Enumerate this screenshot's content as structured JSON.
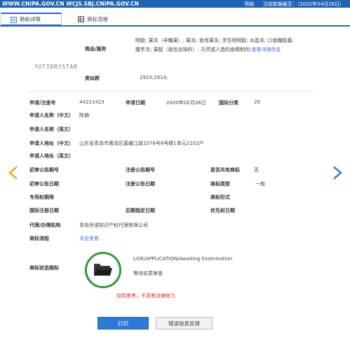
{
  "topbar": {
    "url": "WWW.CNIPA.GOV.CN WCJS.SBJ.CNIPA.GOV.CN",
    "help": "帮助",
    "data_date": "当前数据截至：（2020年04月28日）"
  },
  "tabs": [
    {
      "label": "商标详情",
      "active": true
    },
    {
      "label": "商标流程",
      "active": false
    }
  ],
  "logo": {
    "text": "YUTIDRYSTAR"
  },
  "fields": {
    "goods_label": "商品/服务",
    "goods_value": "明胶; 果冻（非糖果）; 果冻; 食用果冻; 烹饪用明胶; 水晶冻; 口香糖胶基; 魔芋冻; 果胶（面包涂抹料）; 天然或人造的香精制剂;",
    "goods_link": "查看详细信息",
    "similar_label": "类似群",
    "similar_value": "2910;2914;",
    "reg_no_label": "申请/注册号",
    "reg_no_value": "44221423",
    "apply_date_label": "申请日期",
    "apply_date_value": "2020年02月26日",
    "intl_class_label": "国际分类",
    "intl_class_value": "29",
    "applicant_cn_label": "申请人名称（中文）",
    "applicant_cn_value": "陈楠",
    "applicant_en_label": "申请人名称（英文）",
    "applicant_en_value": "",
    "address_cn_label": "申请人地址（中文）",
    "address_cn_value": "山东省青岛市黄岛区嘉嵋江路1076号6号楼1单元2102户",
    "address_en_label": "申请人地址（英文）",
    "address_en_value": "",
    "prelim_no_label": "初审公告期号",
    "prelim_no_value": "",
    "reg_pub_no_label": "注册公告期号",
    "reg_pub_no_value": "",
    "shared_label": "是否共有商标",
    "shared_value": "否",
    "prelim_date_label": "初审公告日期",
    "prelim_date_value": "",
    "reg_pub_date_label": "注册公告日期",
    "reg_pub_date_value": "",
    "type_label": "商标类型",
    "type_value": "一般",
    "exclusive_label": "专用权期限",
    "exclusive_value": "",
    "form_label": "商标形式",
    "form_value": "",
    "intl_reg_date_label": "国际注册日期",
    "intl_reg_date_value": "",
    "later_date_label": "后期指定日期",
    "later_date_value": "",
    "priority_label": "优先权日期",
    "priority_value": "",
    "agent_label": "代理/办理机构",
    "agent_value": "青岛世诺知识产权代理有限公司",
    "flow_label": "商标流程",
    "flow_link": "点击查看",
    "status_icon_label": "商标状态图标",
    "status_en": "LIVE/APPLICATION/Awaiting Examination",
    "status_cn": "等待实质审查"
  },
  "warning": "仅供参考，不具有法律效力",
  "buttons": {
    "print": "打印",
    "feedback": "错误信息反馈"
  },
  "colors": {
    "topbar": "#1f63b3",
    "accent": "#2a67c8",
    "status_ring": "#2e9a3a",
    "warning": "#e02020",
    "prev_arrow": "#f5a623",
    "next_arrow": "#3a7bd5"
  }
}
